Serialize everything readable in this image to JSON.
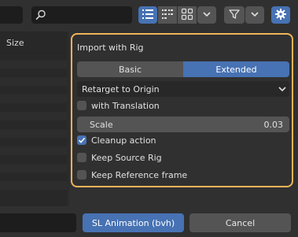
{
  "toolbar": {
    "search": {
      "value": "",
      "icon": "search-icon"
    },
    "view_buttons": [
      {
        "icon": "vertical-list-icon",
        "active": true
      },
      {
        "icon": "horizontal-list-icon",
        "active": false
      },
      {
        "icon": "thumbnails-icon",
        "active": false
      }
    ],
    "view_dropdown_icon": "chevron-down-icon",
    "filter_icon": "filter-icon",
    "filter_dropdown_icon": "chevron-down-icon",
    "settings_icon": "gear-icon",
    "settings_active": true
  },
  "file_list": {
    "column_size": "Size"
  },
  "panel": {
    "title": "Import with Rig",
    "mode_tabs": [
      {
        "label": "Basic",
        "selected": false
      },
      {
        "label": "Extended",
        "selected": true
      }
    ],
    "retarget": {
      "value": "Retarget to Origin",
      "icon": "chevron-down-icon"
    },
    "options": {
      "with_translation": {
        "label": "with Translation",
        "checked": false
      },
      "scale": {
        "label": "Scale",
        "value": "0.03"
      },
      "cleanup_action": {
        "label": "Cleanup action",
        "checked": true
      },
      "keep_source_rig": {
        "label": "Keep Source Rig",
        "checked": false
      },
      "keep_reference_frame": {
        "label": "Keep Reference frame",
        "checked": false
      }
    }
  },
  "footer": {
    "import_button": "SL Animation (bvh)",
    "cancel_button": "Cancel"
  },
  "colors": {
    "accent": "#4772b3",
    "highlight_outline": "#f0b35a",
    "background": "#303030"
  }
}
